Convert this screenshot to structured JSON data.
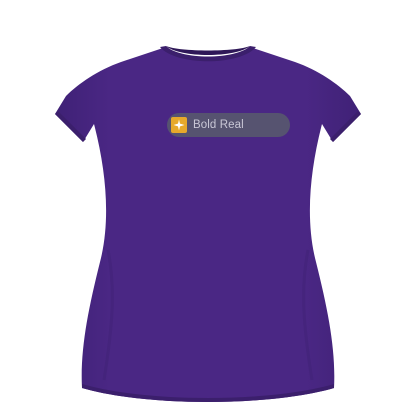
{
  "product": {
    "type": "women's fitted t-shirt",
    "shirt_color": "#4a2784",
    "shirt_shadow_color": "#3b1f6c",
    "shirt_highlight_color": "#5a34a0"
  },
  "print": {
    "label": "Bold Real",
    "badge_bg": "#565370",
    "badge_text_color": "#c9c7d6",
    "icon_bg": "#e7a92b",
    "icon_fg": "#ffffff",
    "icon": "sparkle-icon"
  }
}
